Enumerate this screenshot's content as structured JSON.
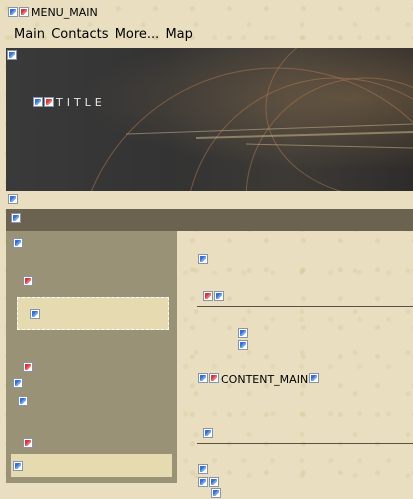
{
  "top": {
    "title": "MENU_MAIN"
  },
  "menu": {
    "items": [
      "Main",
      "Contacts",
      "More...",
      "Map"
    ]
  },
  "banner": {
    "title": "TITLE"
  },
  "content": {
    "label": "CONTENT_MAIN"
  },
  "colors": {
    "page_bg": "#e9dfc0",
    "banner_bg": "#353433",
    "bar": "#6b6350",
    "sidebar": "#9a9277",
    "sidebar_panel": "#e6dbb0"
  },
  "icons": [
    "broken-image-icon"
  ]
}
